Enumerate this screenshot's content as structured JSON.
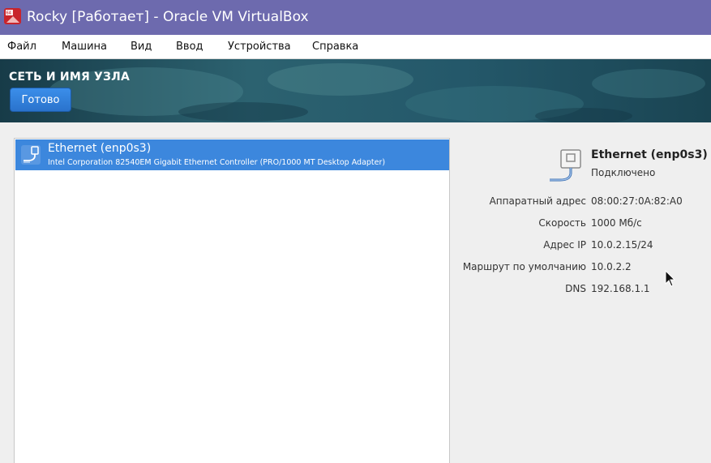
{
  "window": {
    "title": "Rocky [Работает] - Oracle VM VirtualBox",
    "app_icon": "virtualbox-icon"
  },
  "menubar": {
    "items": [
      {
        "label": "Файл"
      },
      {
        "label": "Машина"
      },
      {
        "label": "Вид"
      },
      {
        "label": "Ввод"
      },
      {
        "label": "Устройства"
      },
      {
        "label": "Справка"
      }
    ]
  },
  "header": {
    "title": "СЕТЬ И ИМЯ УЗЛА",
    "done_label": "Готово"
  },
  "devices": [
    {
      "name": "Ethernet (enp0s3)",
      "description": "Intel Corporation 82540EM Gigabit Ethernet Controller (PRO/1000 MT Desktop Adapter)",
      "icon": "ethernet-icon",
      "selected": true
    }
  ],
  "details": {
    "name": "Ethernet (enp0s3)",
    "status": "Подключено",
    "icon": "ethernet-cable-icon",
    "properties": [
      {
        "label": "Аппаратный адрес",
        "value": "08:00:27:0A:82:A0"
      },
      {
        "label": "Скорость",
        "value": "1000 Мб/с"
      },
      {
        "label": "Адрес IP",
        "value": "10.0.2.15/24"
      },
      {
        "label": "Маршрут по умолчанию",
        "value": "10.0.2.2"
      },
      {
        "label": "DNS",
        "value": "192.168.1.1"
      }
    ]
  },
  "colors": {
    "titlebar": "#6d6aae",
    "selection": "#3c87dd",
    "done_button": "#2f7fdc",
    "banner_dark": "#163845",
    "banner_light": "#3f7d8a"
  }
}
